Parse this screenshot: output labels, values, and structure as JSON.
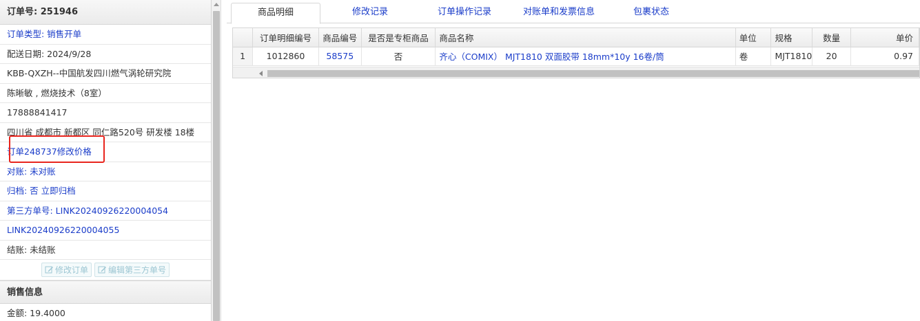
{
  "order": {
    "title": "订单号: 251946",
    "rows": [
      {
        "text": "订单类型: 销售开单"
      },
      {
        "text": "配送日期: 2024/9/28"
      },
      {
        "text": "KBB-QXZH--中国航发四川燃气涡轮研究院"
      },
      {
        "text": "陈晰敏 , 燃烧技术（8室）"
      },
      {
        "text": "17888841417"
      },
      {
        "text": "四川省 成都市 新都区 同仁路520号 研发楼 18楼"
      },
      {
        "text": "订单248737修改价格"
      },
      {
        "text": "对账: 未对账"
      },
      {
        "text": "归档:  否 立即归档"
      },
      {
        "text": "第三方单号: LINK20240926220004054"
      },
      {
        "text": "LINK20240926220004055"
      },
      {
        "text": "结账: 未结账"
      }
    ],
    "buttons": {
      "edit_order": "修改订单",
      "edit_third_party": "编辑第三方单号"
    }
  },
  "sales": {
    "title": "销售信息",
    "amount": "金额: 19.4000"
  },
  "tabs": [
    {
      "label": "商品明细",
      "active": true
    },
    {
      "label": "修改记录"
    },
    {
      "label": "订单操作记录"
    },
    {
      "label": "对账单和发票信息"
    },
    {
      "label": "包裹状态"
    }
  ],
  "grid": {
    "columns": [
      "",
      "订单明细编号",
      "商品编号",
      "是否是专柜商品",
      "商品名称",
      "单位",
      "规格",
      "数量",
      "单价"
    ],
    "rows": [
      [
        "1",
        "1012860",
        "58575",
        "否",
        "齐心（COMIX） MJT1810 双面胶带 18mm*10y 16卷/筒",
        "卷",
        "MJT1810",
        "20",
        "0.97"
      ]
    ]
  },
  "colors": {
    "link": "#1a3cc9",
    "highlight": "#e8241d"
  }
}
